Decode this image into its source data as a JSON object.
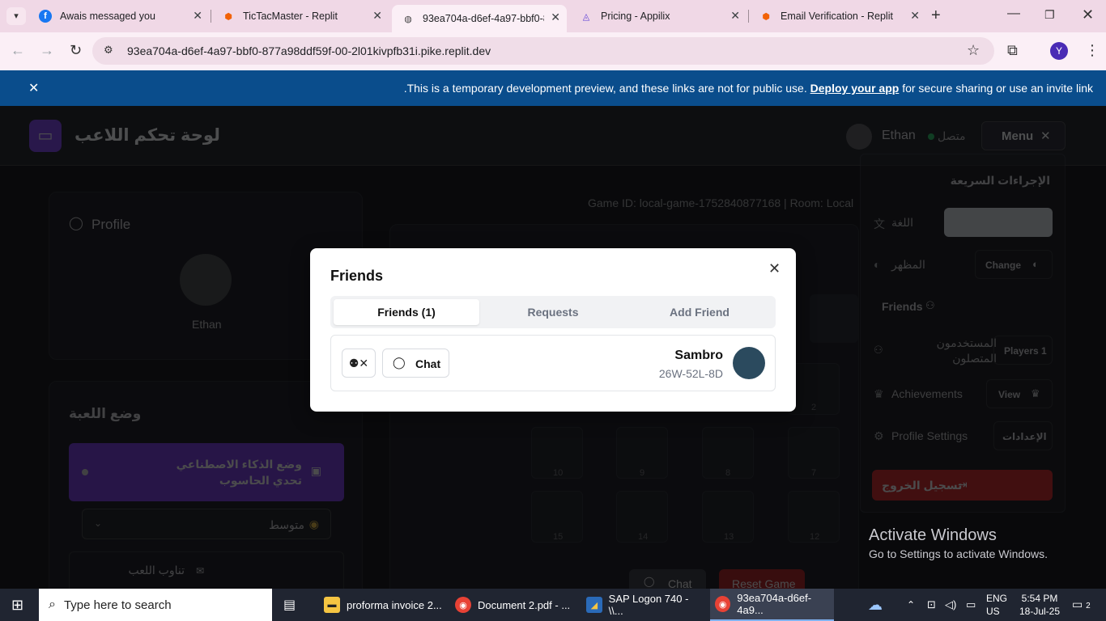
{
  "browser": {
    "tabs": [
      {
        "title": "Awais messaged you"
      },
      {
        "title": "TicTacMaster - Replit"
      },
      {
        "title": "93ea704a-d6ef-4a97-bbf0-8"
      },
      {
        "title": "Pricing - Appilix"
      },
      {
        "title": "Email Verification - Replit"
      }
    ],
    "url": "93ea704a-d6ef-4a97-bbf0-877a98ddf59f-00-2l01kivpfb31i.pike.replit.dev",
    "profile_initial": "Y"
  },
  "banner": {
    "text_before": ".This is a temporary development preview, and these links are not for public use.",
    "link": "Deploy your app",
    "text_after": "for secure sharing or use an invite link"
  },
  "header": {
    "title": "لوحة تحكم اللاعب",
    "user_name": "Ethan",
    "status": "متصل",
    "menu_label": "Menu"
  },
  "profile": {
    "heading": "Profile",
    "name": "Ethan"
  },
  "game_mode": {
    "heading": "وضع اللعبة",
    "ai_title": "وضع الذكاء الاصطناعي",
    "ai_subtitle": "تحدي الحاسوب",
    "difficulty": "متوسط",
    "rotation_title": "تناوب اللعب"
  },
  "game": {
    "info": "Game ID: local-game-1752840877168 | Room: Local",
    "cells": [
      "2",
      "10",
      "9",
      "8",
      "7",
      "15",
      "14",
      "13",
      "12"
    ],
    "chat_button": "Chat",
    "reset_button": "Reset Game"
  },
  "quick_menu": {
    "heading": "الإجراءات السريعة",
    "language_label": "اللغة",
    "theme_label": "المظهر",
    "theme_button": "Change",
    "friends_label": "Friends",
    "online_users_label": "المستخدمون المتصلون",
    "players_button": "Players 1",
    "achievements_label": "Achievements",
    "view_button": "View",
    "profile_settings_label": "Profile Settings",
    "settings_button": "الإعدادات",
    "logout_button": "تسجيل الخروج"
  },
  "modal": {
    "title": "Friends",
    "tabs": [
      "Friends (1)",
      "Requests",
      "Add Friend"
    ],
    "friend": {
      "name": "Sambro",
      "code": "26W-52L-8D",
      "chat_label": "Chat"
    }
  },
  "watermark": {
    "title": "Activate Windows",
    "subtitle": "Go to Settings to activate Windows."
  },
  "taskbar": {
    "search_placeholder": "Type here to search",
    "apps": [
      {
        "label": "proforma invoice 2..."
      },
      {
        "label": "Document 2.pdf - ..."
      },
      {
        "label": "SAP Logon 740 - \\\\..."
      },
      {
        "label": "93ea704a-d6ef-4a9..."
      }
    ],
    "lang_top": "ENG",
    "lang_bottom": "US",
    "time": "5:54 PM",
    "date": "18-Jul-25",
    "notification_count": "2"
  }
}
